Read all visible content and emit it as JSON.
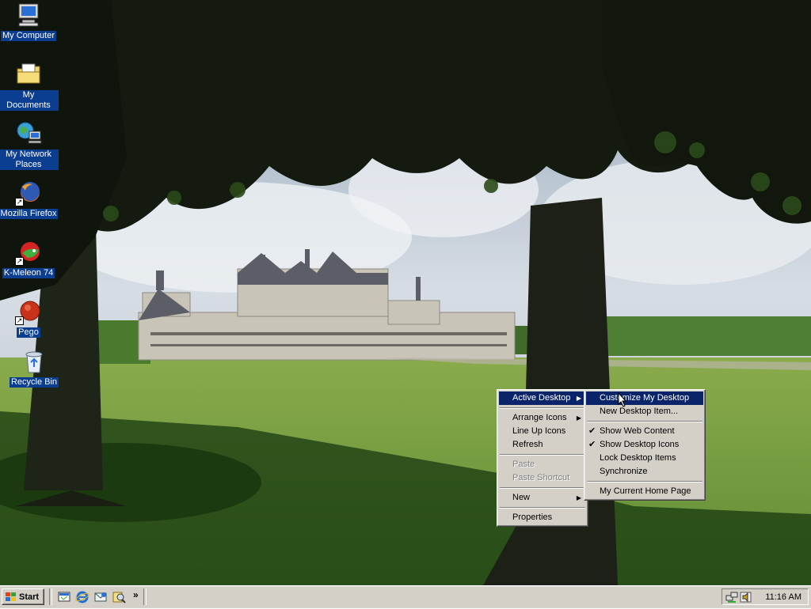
{
  "desktop": {
    "icons": [
      {
        "label": "My Computer",
        "icon": "my-computer-icon"
      },
      {
        "label": "My Documents",
        "icon": "my-documents-folder-icon"
      },
      {
        "label": "My Network Places",
        "icon": "network-places-icon"
      },
      {
        "label": "Mozilla Firefox",
        "icon": "firefox-icon"
      },
      {
        "label": "K-Meleon 74",
        "icon": "k-meleon-icon"
      },
      {
        "label": "Pego",
        "icon": "pego-icon"
      },
      {
        "label": "Recycle Bin",
        "icon": "recycle-bin-icon"
      }
    ]
  },
  "context_menu": {
    "items": [
      {
        "label": "Active Desktop",
        "submenu": true,
        "selected": true
      },
      {
        "label": "Arrange Icons",
        "submenu": true
      },
      {
        "label": "Line Up Icons"
      },
      {
        "label": "Refresh"
      },
      {
        "label": "Paste",
        "disabled": true
      },
      {
        "label": "Paste Shortcut",
        "disabled": true
      },
      {
        "label": "New",
        "submenu": true
      },
      {
        "label": "Properties"
      }
    ]
  },
  "submenu": {
    "items": [
      {
        "label": "Customize My Desktop",
        "selected": true
      },
      {
        "label": "New Desktop Item..."
      },
      {
        "label": "Show Web Content",
        "checked": true
      },
      {
        "label": "Show Desktop Icons",
        "checked": true
      },
      {
        "label": "Lock Desktop Items"
      },
      {
        "label": "Synchronize"
      },
      {
        "label": "My Current Home Page"
      }
    ]
  },
  "taskbar": {
    "start_label": "Start",
    "more_label": "»",
    "quick_launch": [
      "show-desktop-icon",
      "internet-explorer-icon",
      "outlook-express-icon",
      "search-icon"
    ],
    "clock": "11:16 AM"
  },
  "colors": {
    "selection": "#0a246a",
    "face": "#d4d0c8",
    "icon_label_bg": "#0b3d91"
  }
}
